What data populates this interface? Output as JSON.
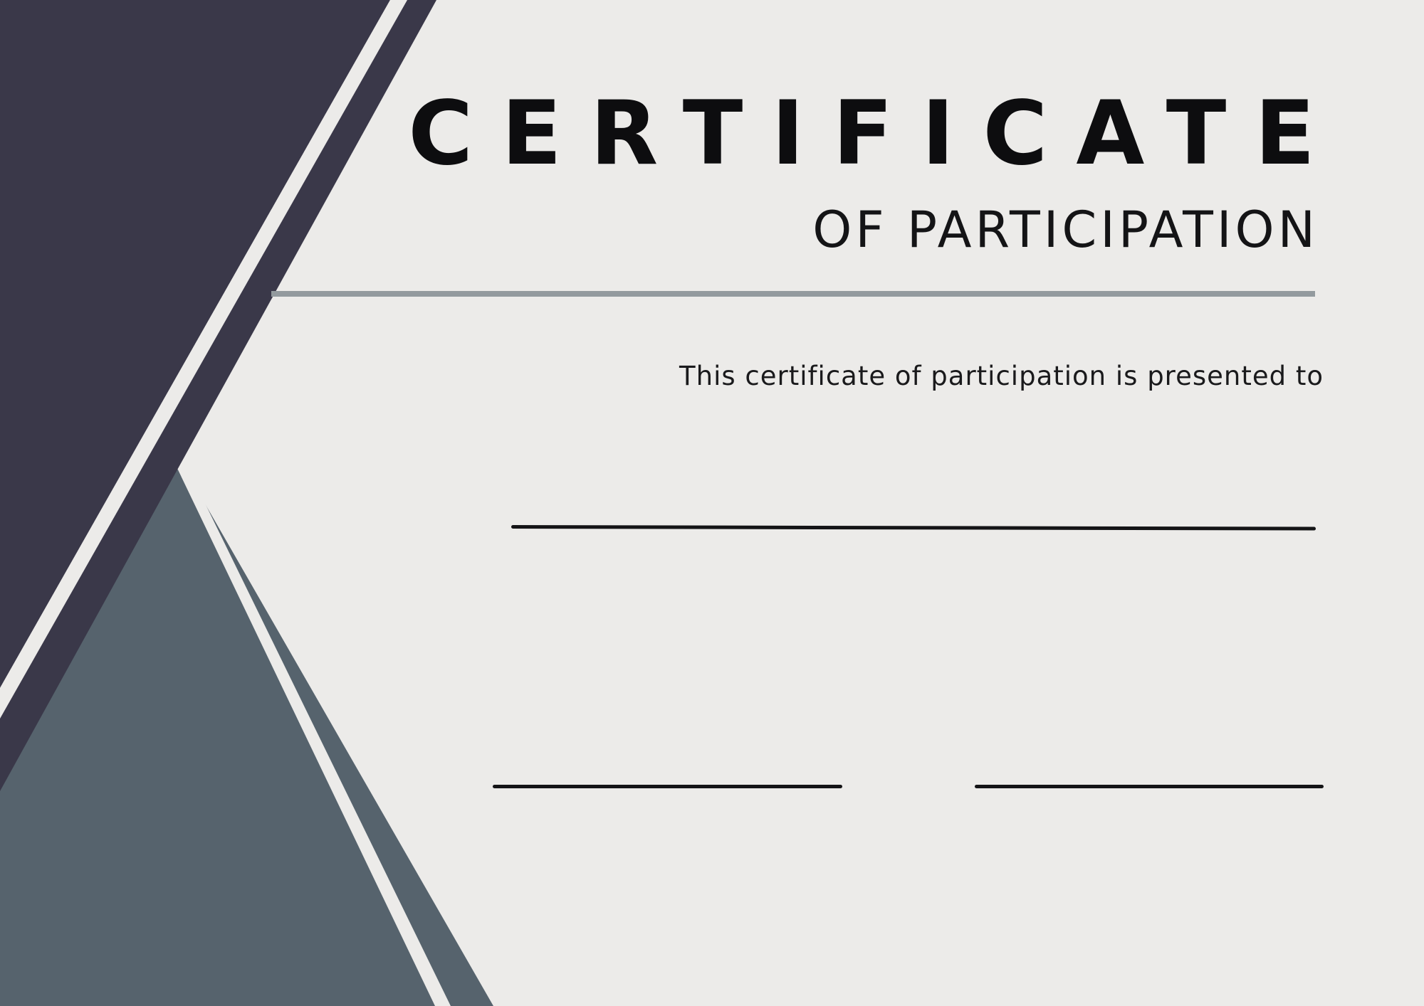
{
  "certificate": {
    "title": "CERTIFICATE",
    "subtitle": "OF PARTICIPATION",
    "presented_text": "This certificate of participation is presented to",
    "recipient_name": "",
    "signature_left": "",
    "signature_right": ""
  },
  "colors": {
    "background": "#ecebe9",
    "dark_navy": "#3a3849",
    "slate": "#56636d",
    "divider": "#939a9e",
    "text": "#0d0d0f"
  }
}
